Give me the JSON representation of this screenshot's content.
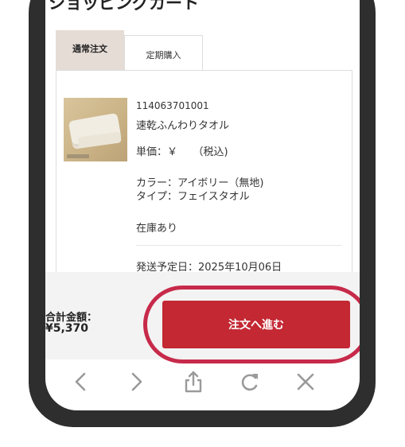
{
  "page": {
    "title": "ショッピングカート"
  },
  "tabs": [
    {
      "label": "通常注文",
      "active": true
    },
    {
      "label": "定期購入",
      "active": false
    }
  ],
  "product": {
    "code": "114063701001",
    "name": "速乾ふんわりタオル",
    "price_label": "単価：￥　　（税込)",
    "color": "カラー：アイボリー（無地)",
    "type": "タイプ：フェイスタオル",
    "stock": "在庫あり",
    "ship_date": "発送予定日：2025年10月06日",
    "image": "folded-towel-photo"
  },
  "footer": {
    "total_label": "合計金額：",
    "total_value": "¥5,370",
    "order_button": "注文へ進む"
  },
  "browser_nav": {
    "icons": [
      "back-icon",
      "forward-icon",
      "share-icon",
      "reload-icon",
      "close-icon"
    ]
  },
  "colors": {
    "accent": "#c32833",
    "highlight": "#c72a4a",
    "tab_active_bg": "#e5dcd6",
    "phone_frame": "#2e2e2e",
    "nav_icon": "#9a9a9a"
  }
}
